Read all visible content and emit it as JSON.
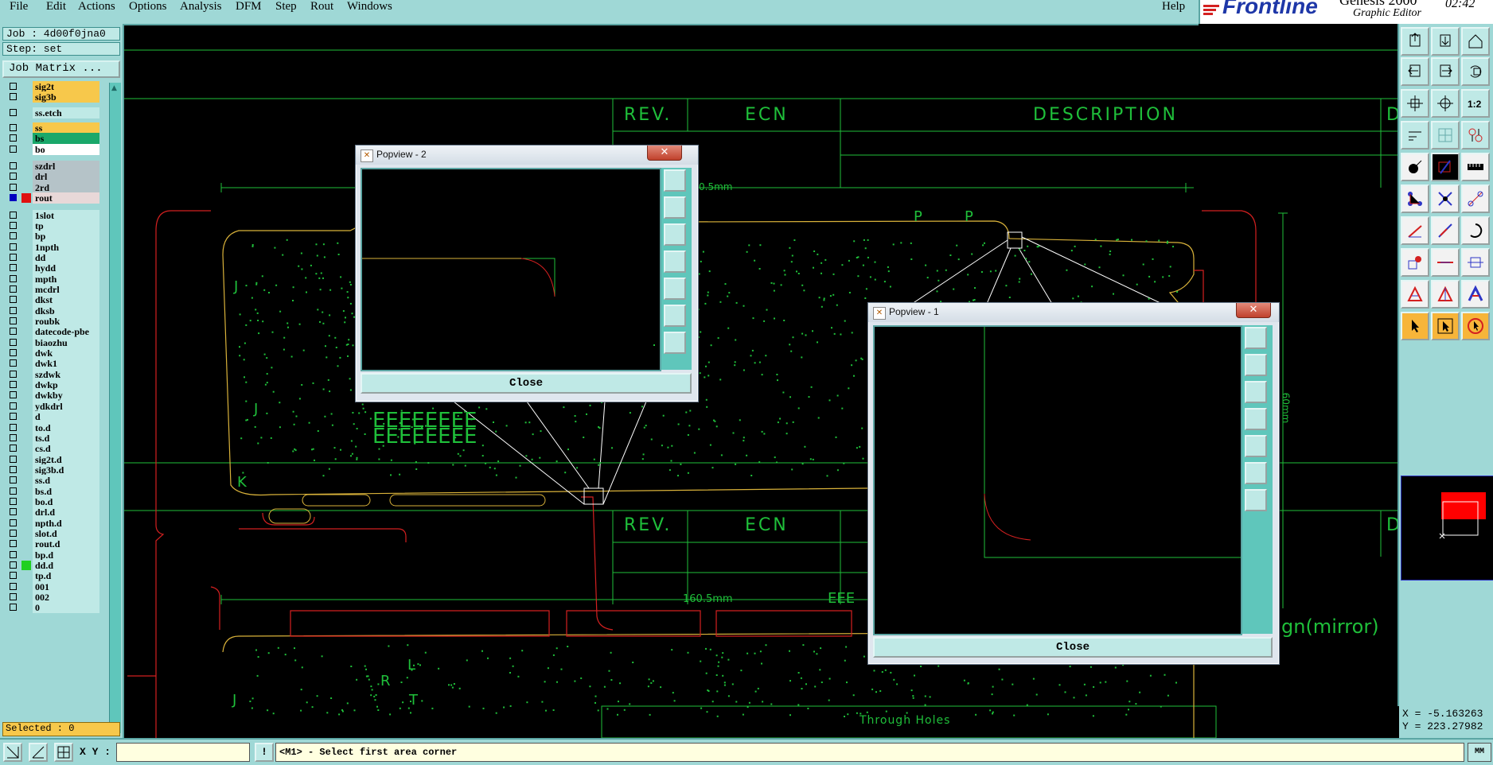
{
  "menu": [
    "File",
    "Edit",
    "Actions",
    "Options",
    "Analysis",
    "DFM",
    "Step",
    "Rout",
    "Windows"
  ],
  "help": "Help",
  "brand": {
    "logo": "Frontline",
    "subtitle": "Graphic Editor",
    "time": "02:42",
    "title_partial": "Genesis 2000"
  },
  "job": {
    "job_label": "Job : 4d00f0jna0",
    "step_label": "Step: set",
    "matrix_button": "Job Matrix ..."
  },
  "layers": [
    {
      "name": "sig2t",
      "color": "#f7c84b",
      "checked": false,
      "swatch": ""
    },
    {
      "name": "sig3b",
      "color": "#f7c84b",
      "checked": false,
      "swatch": ""
    },
    {
      "name": "ss.etch",
      "color": "#bfe9e6",
      "checked": false,
      "swatch": ""
    },
    {
      "name": "ss",
      "color": "#f7c84b",
      "checked": false,
      "swatch": ""
    },
    {
      "name": "bs",
      "color": "#1aa86a",
      "checked": false,
      "swatch": ""
    },
    {
      "name": "bo",
      "color": "#ffffff",
      "checked": false,
      "swatch": ""
    },
    {
      "name": "szdrl",
      "color": "#b5c3c8",
      "checked": false,
      "swatch": ""
    },
    {
      "name": "drl",
      "color": "#b5c3c8",
      "checked": false,
      "swatch": ""
    },
    {
      "name": "2rd",
      "color": "#b5c3c8",
      "checked": false,
      "swatch": ""
    },
    {
      "name": "rout",
      "color": "#e8d8d8",
      "checked": true,
      "swatch": "#e01010"
    },
    {
      "name": "1slot",
      "color": "#bfe9e6",
      "checked": false,
      "swatch": ""
    },
    {
      "name": "tp",
      "color": "#bfe9e6",
      "checked": false,
      "swatch": ""
    },
    {
      "name": "bp",
      "color": "#bfe9e6",
      "checked": false,
      "swatch": ""
    },
    {
      "name": "1npth",
      "color": "#bfe9e6",
      "checked": false,
      "swatch": ""
    },
    {
      "name": "dd",
      "color": "#bfe9e6",
      "checked": false,
      "swatch": ""
    },
    {
      "name": "hydd",
      "color": "#bfe9e6",
      "checked": false,
      "swatch": ""
    },
    {
      "name": "mpth",
      "color": "#bfe9e6",
      "checked": false,
      "swatch": ""
    },
    {
      "name": "mcdrl",
      "color": "#bfe9e6",
      "checked": false,
      "swatch": ""
    },
    {
      "name": "dkst",
      "color": "#bfe9e6",
      "checked": false,
      "swatch": ""
    },
    {
      "name": "dksb",
      "color": "#bfe9e6",
      "checked": false,
      "swatch": ""
    },
    {
      "name": "roubk",
      "color": "#bfe9e6",
      "checked": false,
      "swatch": ""
    },
    {
      "name": "datecode-pbe",
      "color": "#bfe9e6",
      "checked": false,
      "swatch": ""
    },
    {
      "name": "biaozhu",
      "color": "#bfe9e6",
      "checked": false,
      "swatch": ""
    },
    {
      "name": "dwk",
      "color": "#bfe9e6",
      "checked": false,
      "swatch": ""
    },
    {
      "name": "dwk1",
      "color": "#bfe9e6",
      "checked": false,
      "swatch": ""
    },
    {
      "name": "szdwk",
      "color": "#bfe9e6",
      "checked": false,
      "swatch": ""
    },
    {
      "name": "dwkp",
      "color": "#bfe9e6",
      "checked": false,
      "swatch": ""
    },
    {
      "name": "dwkby",
      "color": "#bfe9e6",
      "checked": false,
      "swatch": ""
    },
    {
      "name": "ydkdrl",
      "color": "#bfe9e6",
      "checked": false,
      "swatch": ""
    },
    {
      "name": "d",
      "color": "#bfe9e6",
      "checked": false,
      "swatch": ""
    },
    {
      "name": "to.d",
      "color": "#bfe9e6",
      "checked": false,
      "swatch": ""
    },
    {
      "name": "ts.d",
      "color": "#bfe9e6",
      "checked": false,
      "swatch": ""
    },
    {
      "name": "cs.d",
      "color": "#bfe9e6",
      "checked": false,
      "swatch": ""
    },
    {
      "name": "sig2t.d",
      "color": "#bfe9e6",
      "checked": false,
      "swatch": ""
    },
    {
      "name": "sig3b.d",
      "color": "#bfe9e6",
      "checked": false,
      "swatch": ""
    },
    {
      "name": "ss.d",
      "color": "#bfe9e6",
      "checked": false,
      "swatch": ""
    },
    {
      "name": "bs.d",
      "color": "#bfe9e6",
      "checked": false,
      "swatch": ""
    },
    {
      "name": "bo.d",
      "color": "#bfe9e6",
      "checked": false,
      "swatch": ""
    },
    {
      "name": "drl.d",
      "color": "#bfe9e6",
      "checked": false,
      "swatch": ""
    },
    {
      "name": "npth.d",
      "color": "#bfe9e6",
      "checked": false,
      "swatch": ""
    },
    {
      "name": "slot.d",
      "color": "#bfe9e6",
      "checked": false,
      "swatch": ""
    },
    {
      "name": "rout.d",
      "color": "#bfe9e6",
      "checked": false,
      "swatch": ""
    },
    {
      "name": "bp.d",
      "color": "#bfe9e6",
      "checked": false,
      "swatch": ""
    },
    {
      "name": "dd.d",
      "color": "#bfe9e6",
      "checked": false,
      "swatch": "#20d020"
    },
    {
      "name": "tp.d",
      "color": "#bfe9e6",
      "checked": false,
      "swatch": ""
    },
    {
      "name": "001",
      "color": "#bfe9e6",
      "checked": false,
      "swatch": ""
    },
    {
      "name": "002",
      "color": "#bfe9e6",
      "checked": false,
      "swatch": ""
    },
    {
      "name": "0",
      "color": "#bfe9e6",
      "checked": false,
      "swatch": ""
    }
  ],
  "selected": "Selected : 0",
  "canvas": {
    "table_headers": [
      "REV.",
      "ECN",
      "DESCRIPTION",
      "D"
    ],
    "table_headers_lower": [
      "REV.",
      "ECN",
      "D"
    ],
    "dim_top": "0.5mm",
    "dim_bottom": "160.5mm",
    "dim_right": "60mm",
    "letters_E": "EEEEEEEE",
    "letters_E2": "EEEEEEEE",
    "letter_J": "J",
    "letter_K": "K",
    "letter_R": "R",
    "letter_L": "L",
    "letter_T": "T",
    "letter_E_small": "EEE",
    "mirror_text": "gn(mirror)",
    "through_holes": "Through Holes",
    "P": "P",
    "colors": {
      "green": "#1fbf3a",
      "red": "#d42020",
      "yellow": "#d9b23a",
      "white": "#ffffff"
    }
  },
  "popview2": {
    "title": "Popview - 2",
    "close": "Close"
  },
  "popview1": {
    "title": "Popview - 1",
    "close": "Close"
  },
  "coords": {
    "x": "X = -5.163263",
    "y": "Y = 223.27982"
  },
  "status": {
    "xy_label": "X Y :",
    "xy_value": "",
    "bang": "!",
    "prompt": "<M1> - Select first area corner",
    "units": "MM"
  }
}
